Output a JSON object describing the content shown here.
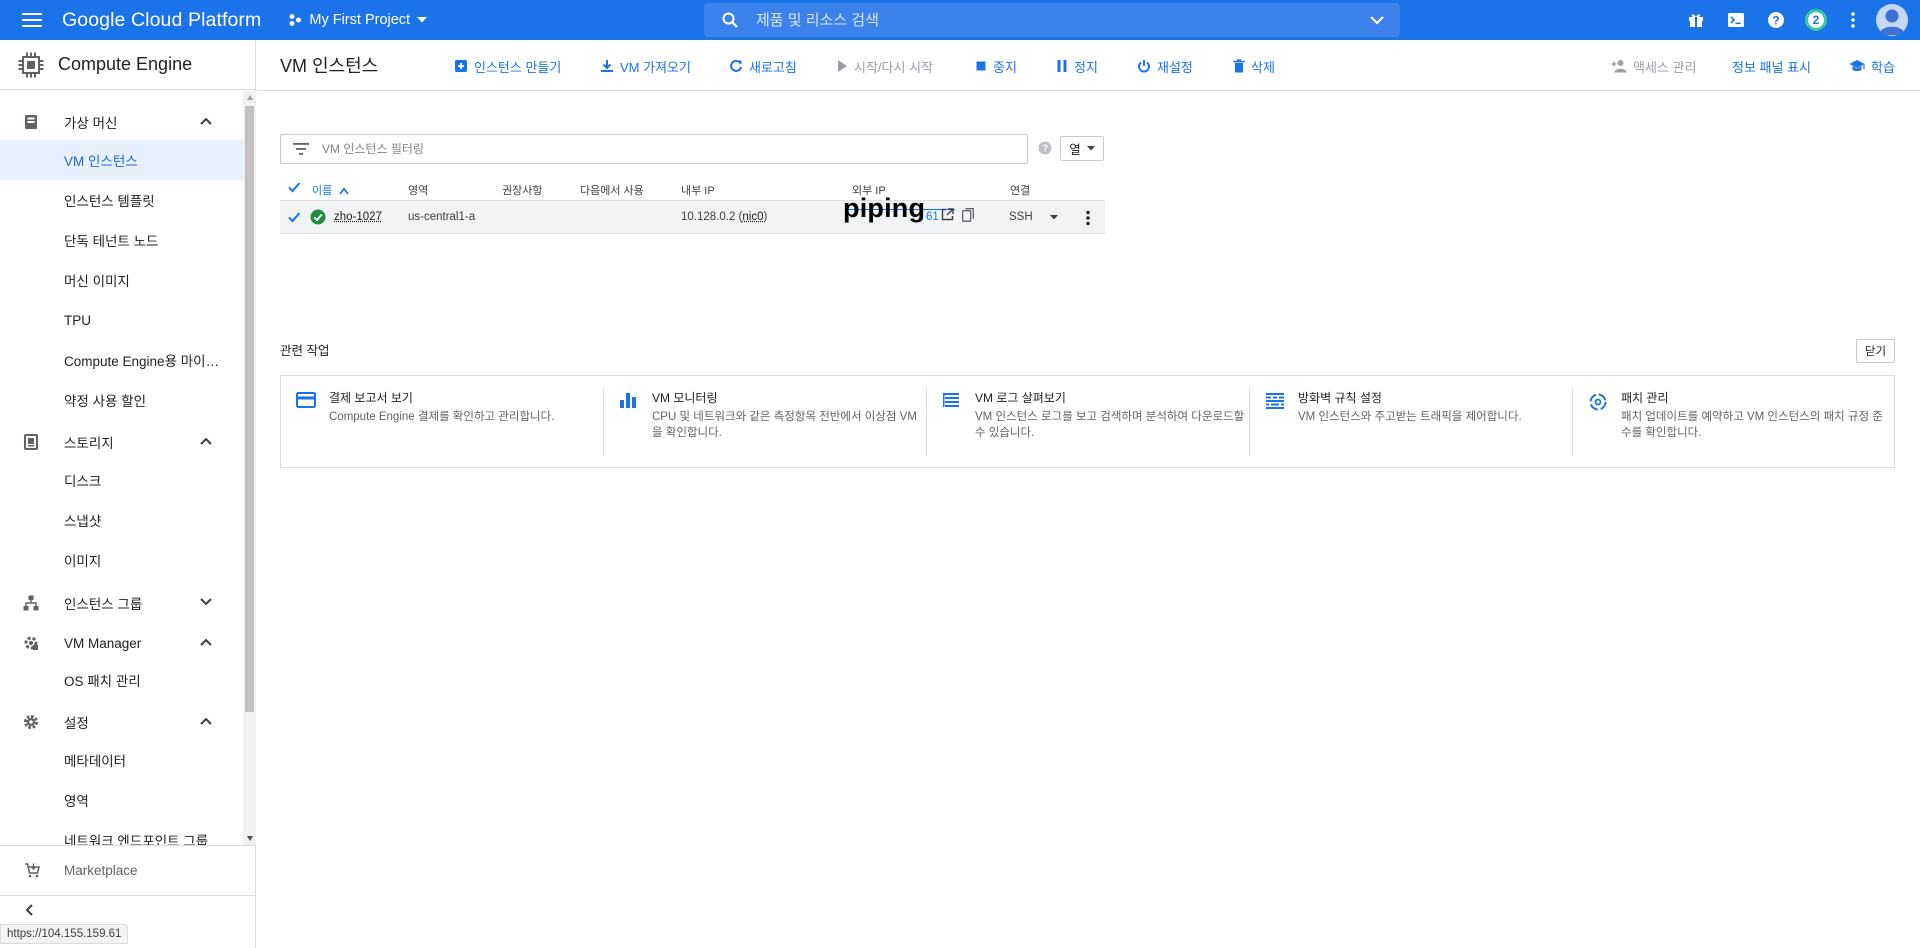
{
  "topbar": {
    "logo": "Google Cloud Platform",
    "project": "My First Project",
    "search_placeholder": "제품 및 리소스 검색",
    "notifications_count": "2"
  },
  "sidebar": {
    "title": "Compute Engine",
    "sections": [
      {
        "label": "가상 머신",
        "icon": "vm-icon",
        "expanded": true
      },
      {
        "label": "스토리지",
        "icon": "storage-icon",
        "expanded": true
      },
      {
        "label": "인스턴스 그룹",
        "icon": "instance-group-icon",
        "expanded": false
      },
      {
        "label": "VM Manager",
        "icon": "vm-manager-icon",
        "expanded": true
      },
      {
        "label": "설정",
        "icon": "gear-icon",
        "expanded": true
      }
    ],
    "vm_items": [
      "VM 인스턴스",
      "인스턴스 템플릿",
      "단독 테넌트 노드",
      "머신 이미지",
      "TPU",
      "Compute Engine용 마이그...",
      "약정 사용 할인"
    ],
    "storage_items": [
      "디스크",
      "스냅샷",
      "이미지"
    ],
    "vm_manager_items": [
      "OS 패치 관리"
    ],
    "settings_items": [
      "메타데이터",
      "영역",
      "네트워크 엔드포인트 그룹"
    ],
    "marketplace": "Marketplace",
    "status_url": "https://104.155.159.61"
  },
  "toolbar": {
    "page_title": "VM 인스턴스",
    "create": "인스턴스 만들기",
    "import_vm": "VM 가져오기",
    "refresh": "새로고침",
    "start": "시작/다시 시작",
    "stop": "중지",
    "suspend": "정지",
    "reset": "재설정",
    "delete": "삭제",
    "access": "액세스 관리",
    "info_panel": "정보 패널 표시",
    "learn": "학습"
  },
  "filter": {
    "placeholder": "VM 인스턴스 필터링",
    "columns_button": "열"
  },
  "table": {
    "headers": {
      "name": "이름",
      "zone": "영역",
      "recommendation": "권장사항",
      "in_use_by": "다음에서 사용",
      "internal_ip": "내부 IP",
      "external_ip": "외부 IP",
      "connect": "연결"
    },
    "rows": [
      {
        "name": "zho-1027",
        "zone": "us-central1-a",
        "internal_ip": "10.128.0.2",
        "nic": "nic0",
        "external_ip_suffix": "61",
        "connect": "SSH",
        "overlay_text": "piping"
      }
    ]
  },
  "related": {
    "title": "관련 작업",
    "close": "닫기",
    "cards": [
      {
        "title": "결제 보고서 보기",
        "desc": "Compute Engine 결제를 확인하고 관리합니다.",
        "icon": "billing-icon"
      },
      {
        "title": "VM 모니터링",
        "desc": "CPU 및 네트워크와 같은 측정항목 전반에서 이상점 VM을 확인합니다.",
        "icon": "monitoring-icon"
      },
      {
        "title": "VM 로그 살펴보기",
        "desc": "VM 인스턴스 로그를 보고 검색하며 분석하여 다운로드할 수 있습니다.",
        "icon": "logs-icon"
      },
      {
        "title": "방화벽 규칙 설정",
        "desc": "VM 인스턴스와 주고받는 트래픽을 제어합니다.",
        "icon": "firewall-icon"
      },
      {
        "title": "패치 관리",
        "desc": "패치 업데이트를 예약하고 VM 인스턴스의 패치 규정 준수를 확인합니다.",
        "icon": "patch-icon"
      }
    ]
  },
  "colors": {
    "brand_blue": "#1a73e8",
    "status_green": "#1e8e3e",
    "active_bg": "#e8f0fe"
  }
}
